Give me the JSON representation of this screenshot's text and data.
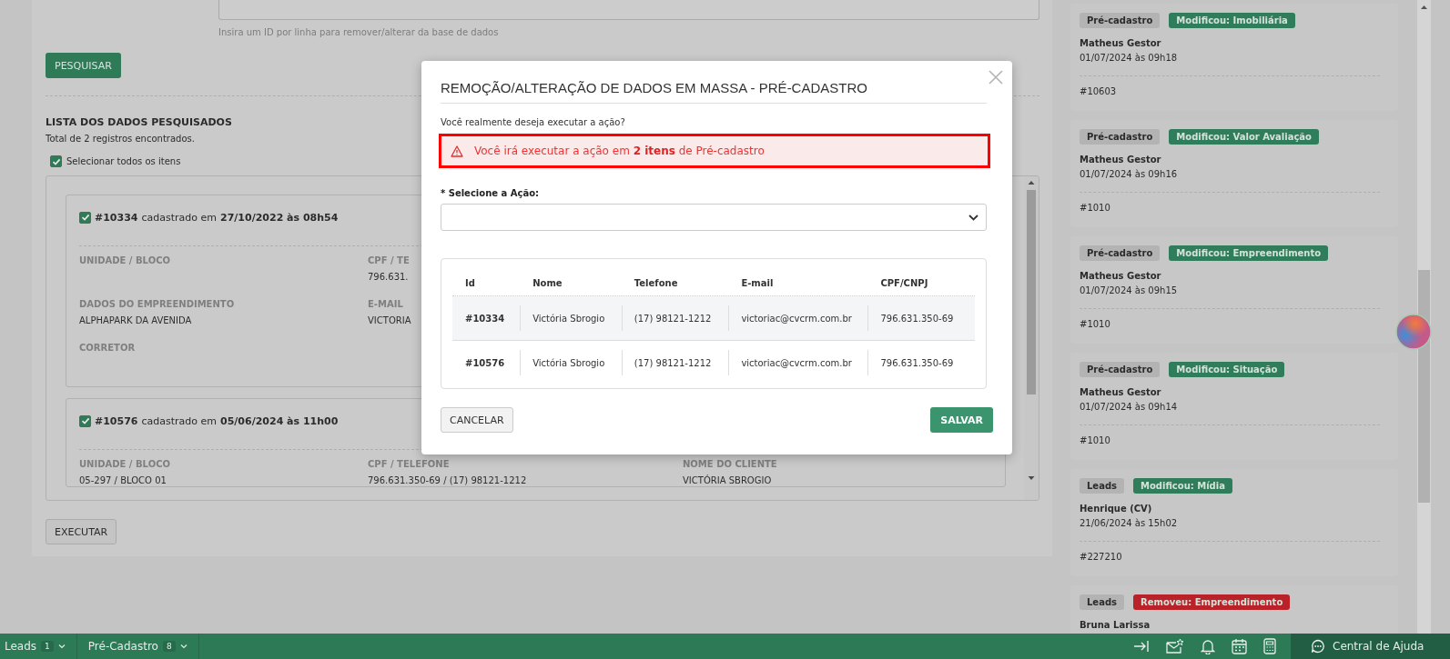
{
  "search_form": {
    "hint": "Insira um ID por linha para remover/alterar da base de dados",
    "search_button": "PESQUISAR"
  },
  "results": {
    "title": "LISTA DOS DADOS PESQUISADOS",
    "total": "Total de 2 registros encontrados.",
    "select_all": {
      "label": "Selecionar todos os itens",
      "checked": true
    },
    "records": [
      {
        "checked": true,
        "id": "#10334",
        "registered": "cadastrado em",
        "date": "27/10/2022 às 08h54",
        "rows": [
          [
            {
              "label": "UNIDADE / BLOCO"
            },
            {
              "label": "CPF / TE",
              "value": "796.631."
            }
          ],
          [
            {
              "label": "DADOS DO EMPREENDIMENTO",
              "value": "ALPHAPARK DA AVENIDA"
            },
            {
              "label": "E-MAIL",
              "value": "VICTORIA"
            }
          ],
          [
            {
              "label": "CORRETOR"
            }
          ]
        ]
      },
      {
        "checked": true,
        "id": "#10576",
        "registered": "cadastrado em",
        "date": "05/06/2024 às 11h00",
        "rows": [
          [
            {
              "label": "UNIDADE / BLOCO",
              "value": "05-297 / BLOCO 01"
            },
            {
              "label": "CPF / TELEFONE",
              "value": "796.631.350-69 / (17) 98121-1212"
            },
            {
              "label": "NOME DO CLIENTE",
              "value": "VICTÓRIA SBROGIO"
            }
          ]
        ]
      }
    ],
    "execute_button": "EXECUTAR"
  },
  "activity": [
    {
      "module": "Pré-cadastro",
      "action": "Modificou: Imobiliária",
      "color": "#307d5c",
      "user": "Matheus Gestor",
      "date": "01/07/2024 às 09h18",
      "ref": "#10603"
    },
    {
      "module": "Pré-cadastro",
      "action": "Modificou: Valor Avaliação",
      "color": "#307d5c",
      "user": "Matheus Gestor",
      "date": "01/07/2024 às 09h16",
      "ref": "#1010"
    },
    {
      "module": "Pré-cadastro",
      "action": "Modificou: Empreendimento",
      "color": "#307d5c",
      "user": "Matheus Gestor",
      "date": "01/07/2024 às 09h15",
      "ref": "#1010"
    },
    {
      "module": "Pré-cadastro",
      "action": "Modificou: Situação",
      "color": "#307d5c",
      "user": "Matheus Gestor",
      "date": "01/07/2024 às 09h14",
      "ref": "#1010"
    },
    {
      "module": "Leads",
      "action": "Modificou: Mídia",
      "color": "#307d5c",
      "user": "Henrique (CV)",
      "date": "21/06/2024 às 15h02",
      "ref": "#227210"
    },
    {
      "module": "Leads",
      "action": "Removeu: Empreendimento",
      "color": "#b92228",
      "user": "Bruna Larissa"
    }
  ],
  "modal": {
    "title": "REMOÇÃO/ALTERAÇÃO DE DADOS EM MASSA - PRÉ-CADASTRO",
    "question": "Você realmente deseja executar a ação?",
    "alert": "Você irá executar a ação em **2 itens** de Pré-cadastro",
    "select_label": "* Selecione a Ação:",
    "table": {
      "columns": [
        "Id",
        "Nome",
        "Telefone",
        "E-mail",
        "CPF/CNPJ"
      ],
      "rows": [
        [
          "#10334",
          "Victória Sbrogio",
          "(17) 98121-1212",
          "victoriac@cvcrm.com.br",
          "796.631.350-69"
        ],
        [
          "#10576",
          "Victória Sbrogio",
          "(17) 98121-1212",
          "victoriac@cvcrm.com.br",
          "796.631.350-69"
        ]
      ]
    },
    "buttons": [
      {
        "kind": "cancel",
        "label": "CANCELAR"
      },
      {
        "kind": "save",
        "label": "SALVAR"
      }
    ]
  },
  "bottom_bar": {
    "tabs": [
      {
        "label": "Leads",
        "count": "1"
      },
      {
        "label": "Pré-Cadastro",
        "count": "8"
      }
    ],
    "help": "Central de Ajuda"
  }
}
